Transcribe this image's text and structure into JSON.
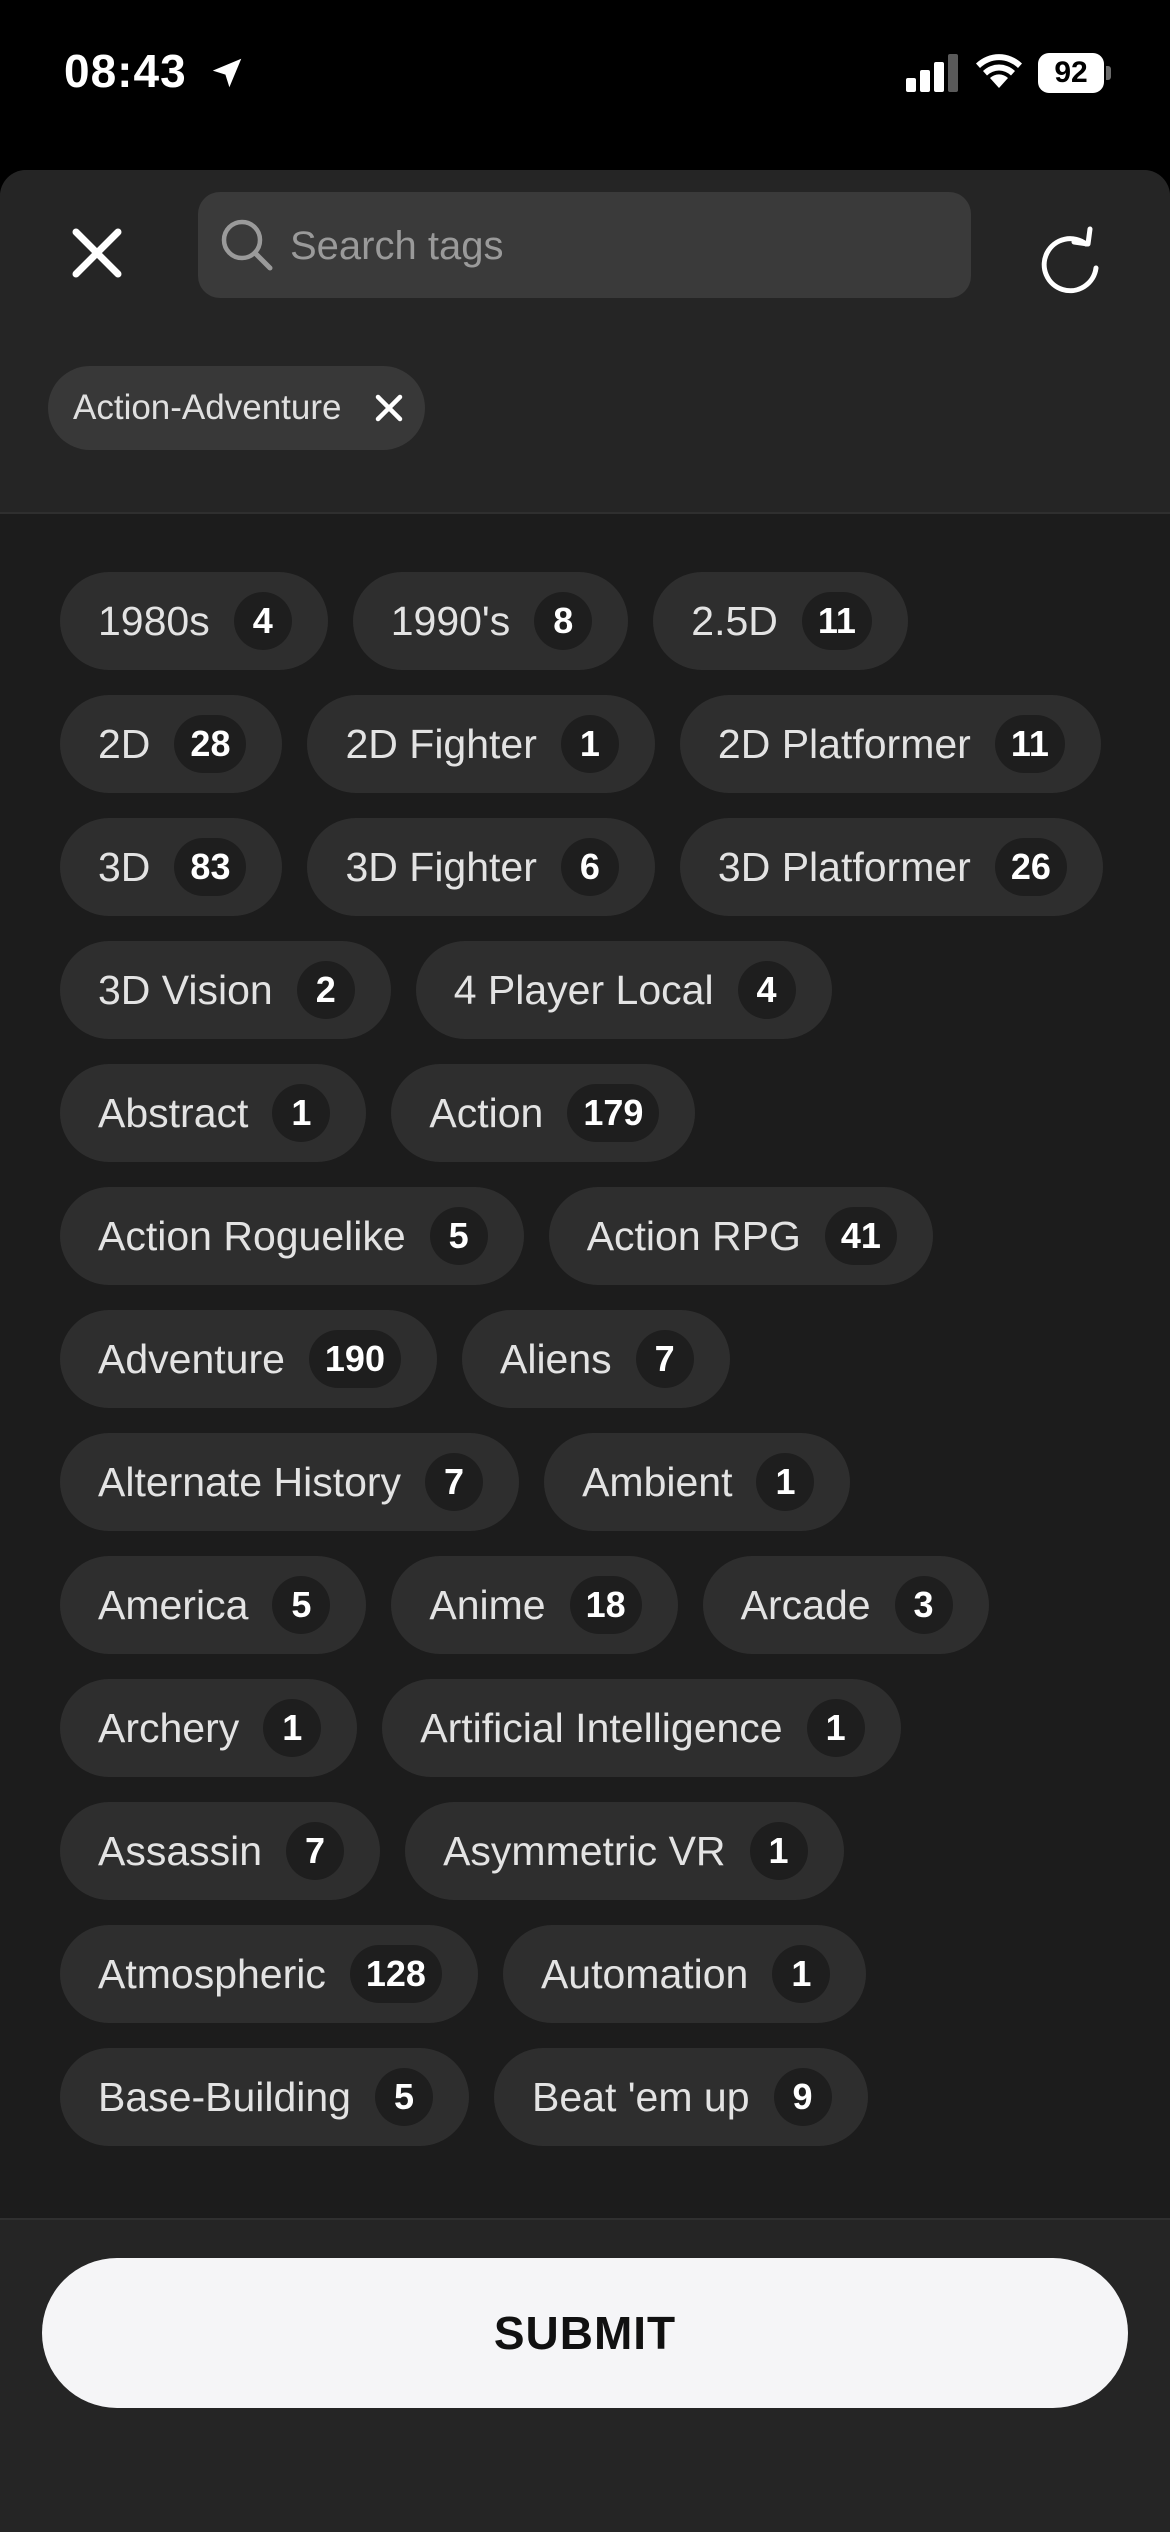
{
  "status_bar": {
    "time": "08:43",
    "battery": "92",
    "icons": [
      "location-arrow-icon",
      "cellular-signal-icon",
      "wifi-icon",
      "battery-icon"
    ]
  },
  "header": {
    "search": {
      "placeholder": "Search tags",
      "value": ""
    },
    "selected_tags": [
      {
        "label": "Action-Adventure"
      }
    ],
    "icons": [
      "close-icon",
      "search-icon",
      "refresh-icon"
    ]
  },
  "tags": [
    {
      "name": "1980s",
      "count": "4"
    },
    {
      "name": "1990's",
      "count": "8"
    },
    {
      "name": "2.5D",
      "count": "11"
    },
    {
      "name": "2D",
      "count": "28"
    },
    {
      "name": "2D Fighter",
      "count": "1"
    },
    {
      "name": "2D Platformer",
      "count": "11"
    },
    {
      "name": "3D",
      "count": "83"
    },
    {
      "name": "3D Fighter",
      "count": "6"
    },
    {
      "name": "3D Platformer",
      "count": "26"
    },
    {
      "name": "3D Vision",
      "count": "2"
    },
    {
      "name": "4 Player Local",
      "count": "4"
    },
    {
      "name": "Abstract",
      "count": "1"
    },
    {
      "name": "Action",
      "count": "179"
    },
    {
      "name": "Action Roguelike",
      "count": "5"
    },
    {
      "name": "Action RPG",
      "count": "41"
    },
    {
      "name": "Adventure",
      "count": "190"
    },
    {
      "name": "Aliens",
      "count": "7"
    },
    {
      "name": "Alternate History",
      "count": "7"
    },
    {
      "name": "Ambient",
      "count": "1"
    },
    {
      "name": "America",
      "count": "5"
    },
    {
      "name": "Anime",
      "count": "18"
    },
    {
      "name": "Arcade",
      "count": "3"
    },
    {
      "name": "Archery",
      "count": "1"
    },
    {
      "name": "Artificial Intelligence",
      "count": "1"
    },
    {
      "name": "Assassin",
      "count": "7"
    },
    {
      "name": "Asymmetric VR",
      "count": "1"
    },
    {
      "name": "Atmospheric",
      "count": "128"
    },
    {
      "name": "Automation",
      "count": "1"
    },
    {
      "name": "Base-Building",
      "count": "5"
    },
    {
      "name": "Beat 'em up",
      "count": "9"
    }
  ],
  "footer": {
    "submit_label": "SUBMIT"
  },
  "colors": {
    "background": "#1c1c1c",
    "panel": "#252525",
    "chip": "#2e2e2e",
    "button": "#f5f5f7"
  }
}
